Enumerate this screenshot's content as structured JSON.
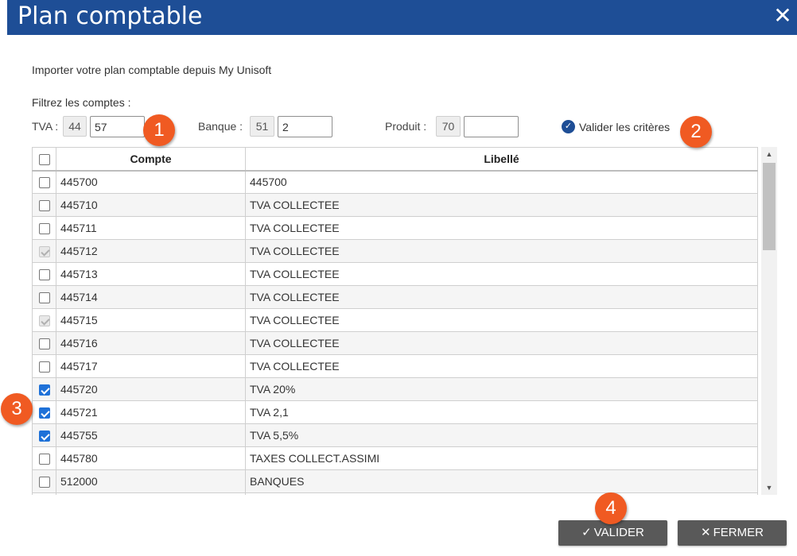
{
  "dialog": {
    "title": "Plan comptable",
    "close_label": "✕"
  },
  "intro": "Importer votre plan comptable depuis My Unisoft",
  "filters": {
    "label": "Filtrez les comptes :",
    "tva": {
      "label": "TVA :",
      "prefix": "44",
      "value": "57"
    },
    "banque": {
      "label": "Banque :",
      "prefix": "51",
      "value": "2"
    },
    "produit": {
      "label": "Produit :",
      "prefix": "70",
      "value": ""
    },
    "validate_label": "Valider les critères"
  },
  "table": {
    "headers": {
      "compte": "Compte",
      "libelle": "Libellé"
    },
    "rows": [
      {
        "compte": "445700",
        "libelle": "445700",
        "state": "unchecked"
      },
      {
        "compte": "445710",
        "libelle": "TVA COLLECTEE",
        "state": "unchecked"
      },
      {
        "compte": "445711",
        "libelle": "TVA COLLECTEE",
        "state": "unchecked"
      },
      {
        "compte": "445712",
        "libelle": "TVA COLLECTEE",
        "state": "disabled"
      },
      {
        "compte": "445713",
        "libelle": "TVA COLLECTEE",
        "state": "unchecked"
      },
      {
        "compte": "445714",
        "libelle": "TVA COLLECTEE",
        "state": "unchecked"
      },
      {
        "compte": "445715",
        "libelle": "TVA COLLECTEE",
        "state": "disabled"
      },
      {
        "compte": "445716",
        "libelle": "TVA COLLECTEE",
        "state": "unchecked"
      },
      {
        "compte": "445717",
        "libelle": "TVA COLLECTEE",
        "state": "unchecked"
      },
      {
        "compte": "445720",
        "libelle": "TVA 20%",
        "state": "checked"
      },
      {
        "compte": "445721",
        "libelle": "TVA 2,1",
        "state": "checked"
      },
      {
        "compte": "445755",
        "libelle": "TVA 5,5%",
        "state": "checked"
      },
      {
        "compte": "445780",
        "libelle": "TAXES COLLECT.ASSIMI",
        "state": "unchecked"
      },
      {
        "compte": "512000",
        "libelle": "BANQUES",
        "state": "unchecked"
      },
      {
        "compte": "",
        "libelle": "",
        "state": "partial"
      }
    ]
  },
  "scrollbar": {
    "up_icon": "▲",
    "down_icon": "▼"
  },
  "buttons": {
    "valider": {
      "icon": "✓",
      "label": "VALIDER"
    },
    "fermer": {
      "icon": "✕",
      "label": "FERMER"
    }
  },
  "badges": [
    "1",
    "2",
    "3",
    "4"
  ],
  "colors": {
    "title_bar": "#1e4e96",
    "badge": "#f05a22",
    "button": "#595959",
    "checkbox_checked": "#1e71d8"
  }
}
